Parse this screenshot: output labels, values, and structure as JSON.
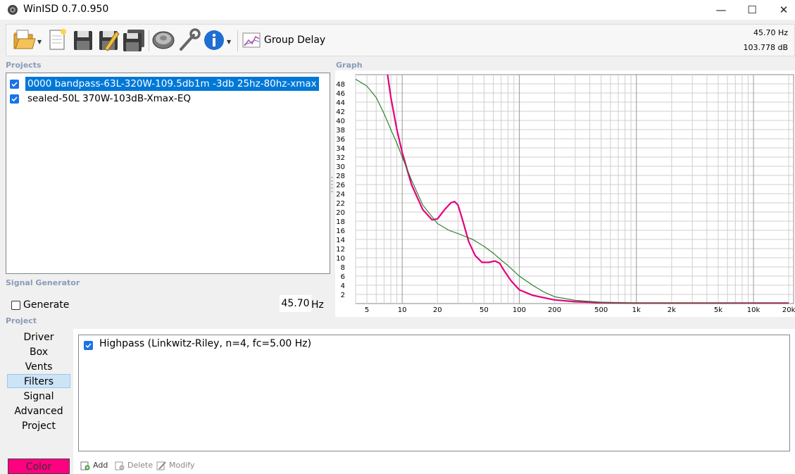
{
  "window": {
    "title": "WinISD 0.7.0.950",
    "minimize": "—",
    "maximize": "☐",
    "close": "✕"
  },
  "toolbar": {
    "buttons": [
      {
        "name": "open-icon"
      },
      {
        "name": "new-icon"
      },
      {
        "name": "save-icon"
      },
      {
        "name": "save-as-icon"
      },
      {
        "name": "save-all-icon"
      },
      {
        "name": "driver-icon"
      },
      {
        "name": "tools-icon"
      },
      {
        "name": "info-icon"
      },
      {
        "name": "group-delay-icon"
      }
    ],
    "graph_type_label": "Group Delay",
    "readout_frequency": "45.70 Hz",
    "readout_level": "103.778 dB"
  },
  "projects": {
    "header": "Projects",
    "items": [
      {
        "label": "0000 bandpass-63L-320W-109.5db1m -3db 25hz-80hz-xmax",
        "checked": true,
        "selected": true
      },
      {
        "label": "sealed-50L 370W-103dB-Xmax-EQ",
        "checked": true,
        "selected": false
      }
    ]
  },
  "signal_generator": {
    "header": "Signal Generator",
    "generate_label": "Generate",
    "generate_checked": false,
    "frequency_value": "45.70",
    "frequency_unit": "Hz"
  },
  "graph": {
    "header": "Graph"
  },
  "chart_data": {
    "type": "line",
    "x_scale": "log",
    "xlim": [
      4,
      22000
    ],
    "ylim": [
      0,
      50
    ],
    "x_tick_labels": [
      {
        "value": 5,
        "label": "5"
      },
      {
        "value": 10,
        "label": "10"
      },
      {
        "value": 20,
        "label": "20"
      },
      {
        "value": 50,
        "label": "50"
      },
      {
        "value": 100,
        "label": "100"
      },
      {
        "value": 200,
        "label": "200"
      },
      {
        "value": 500,
        "label": "500"
      },
      {
        "value": 1000,
        "label": "1k"
      },
      {
        "value": 2000,
        "label": "2k"
      },
      {
        "value": 5000,
        "label": "5k"
      },
      {
        "value": 10000,
        "label": "10k"
      },
      {
        "value": 20000,
        "label": "20k"
      }
    ],
    "y_tick_labels": [
      "2",
      "4",
      "6",
      "8",
      "10",
      "12",
      "14",
      "16",
      "18",
      "20",
      "22",
      "24",
      "26",
      "28",
      "30",
      "32",
      "34",
      "36",
      "38",
      "40",
      "42",
      "44",
      "46",
      "48"
    ],
    "grid": true,
    "series": [
      {
        "color": "#e6007e",
        "x": [
          7.5,
          8,
          9,
          10,
          12,
          15,
          18,
          20,
          23,
          26,
          28,
          30,
          33,
          37,
          42,
          48,
          55,
          62,
          68,
          75,
          85,
          100,
          130,
          200,
          300,
          500,
          1000,
          3000,
          10000,
          20000
        ],
        "y": [
          50,
          45,
          38,
          33,
          26,
          20.5,
          18.3,
          18.5,
          20.5,
          22,
          22.3,
          21.5,
          18,
          13.5,
          10.5,
          9,
          9,
          9.3,
          8.8,
          7,
          5,
          3,
          1.8,
          0.8,
          0.4,
          0.2,
          0.1,
          0.1,
          0.1,
          0.1
        ]
      },
      {
        "color": "#1e7a1e",
        "x": [
          4,
          5,
          6,
          7,
          8,
          9,
          10,
          12,
          15,
          20,
          25,
          30,
          40,
          50,
          60,
          70,
          80,
          100,
          130,
          160,
          200,
          300,
          500,
          1000,
          20000
        ],
        "y": [
          49,
          47.5,
          45,
          41.5,
          38,
          35,
          32,
          27,
          21.5,
          17.5,
          16,
          15.3,
          14,
          12.5,
          11,
          9.5,
          8.3,
          6,
          4,
          2.6,
          1.5,
          0.7,
          0.3,
          0.1,
          0
        ]
      }
    ]
  },
  "project_nav": {
    "header": "Project",
    "items": [
      "Driver",
      "Box",
      "Vents",
      "Filters",
      "Signal",
      "Advanced",
      "Project"
    ],
    "active": "Filters",
    "color_label": "Color",
    "color_value": "#ff0080"
  },
  "filters": {
    "items": [
      {
        "label": "Highpass (Linkwitz-Riley, n=4, fc=5.00 Hz)",
        "checked": true
      }
    ],
    "add_label": "Add",
    "delete_label": "Delete",
    "modify_label": "Modify"
  }
}
